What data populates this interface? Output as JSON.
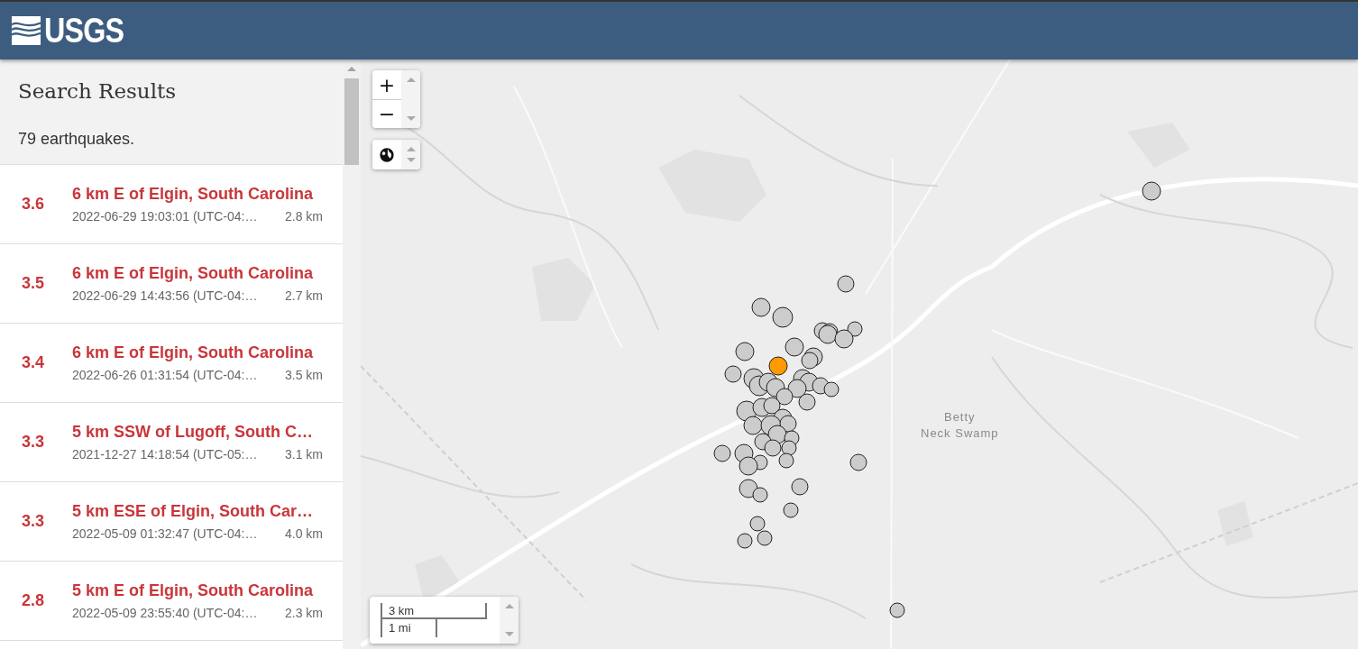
{
  "header": {
    "logo": "USGS"
  },
  "sidebar": {
    "title": "Search Results",
    "count": "79 earthquakes.",
    "results": [
      {
        "magnitude": "3.6",
        "place": "6 km E of Elgin, South Carolina",
        "time": "2022-06-29 19:03:01 (UTC-04:…",
        "depth": "2.8 km"
      },
      {
        "magnitude": "3.5",
        "place": "6 km E of Elgin, South Carolina",
        "time": "2022-06-29 14:43:56 (UTC-04:…",
        "depth": "2.7 km"
      },
      {
        "magnitude": "3.4",
        "place": "6 km E of Elgin, South Carolina",
        "time": "2022-06-26 01:31:54 (UTC-04:…",
        "depth": "3.5 km"
      },
      {
        "magnitude": "3.3",
        "place": "5 km SSW of Lugoff, South C…",
        "time": "2021-12-27 14:18:54 (UTC-05:…",
        "depth": "3.1 km"
      },
      {
        "magnitude": "3.3",
        "place": "5 km ESE of Elgin, South Car…",
        "time": "2022-05-09 01:32:47 (UTC-04:…",
        "depth": "4.0 km"
      },
      {
        "magnitude": "2.8",
        "place": "5 km E of Elgin, South Carolina",
        "time": "2022-05-09 23:55:40 (UTC-04:…",
        "depth": "2.3 km"
      }
    ]
  },
  "map": {
    "zoom_in": "+",
    "zoom_out": "−",
    "place_label": "Betty\nNeck Swamp",
    "scale": {
      "metric": "3 km",
      "imperial": "1 mi"
    }
  }
}
